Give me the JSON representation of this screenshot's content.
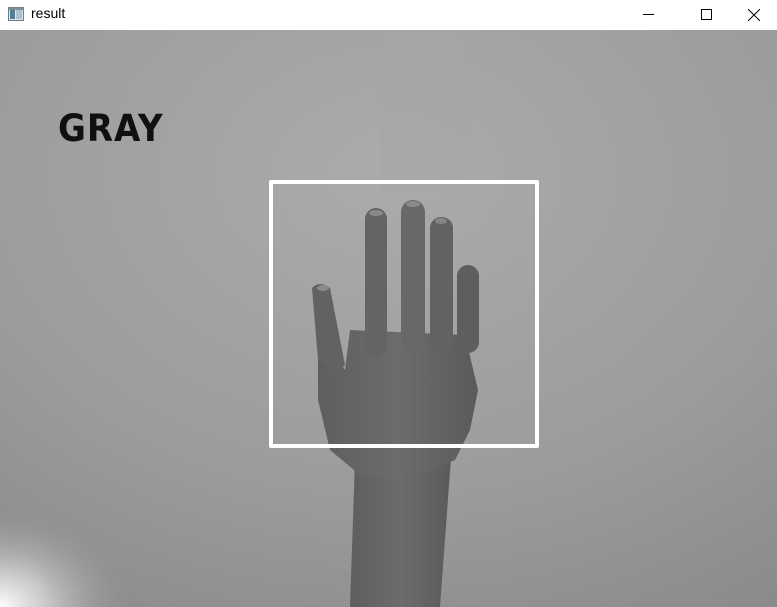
{
  "window": {
    "title": "result",
    "icon": "app-window-icon",
    "controls": {
      "minimize_icon": "minimize-icon",
      "maximize_icon": "maximize-icon",
      "close_icon": "close-icon"
    }
  },
  "viewport": {
    "overlay_label": "GRAY",
    "detection_box_color": "#ffffff",
    "scene_description_icon": "grayscale-hand-camera-frame"
  }
}
